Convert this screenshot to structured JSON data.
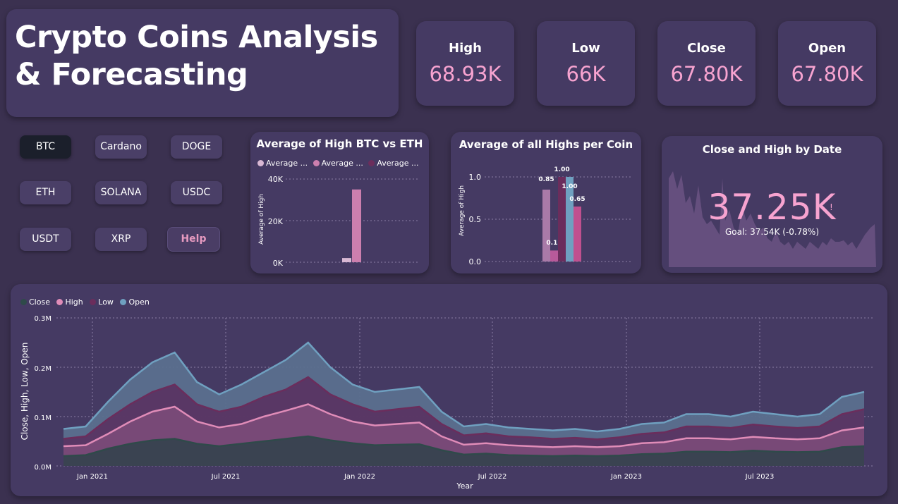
{
  "title": "Crypto Coins Analysis & Forecasting",
  "kpis": [
    {
      "label": "High",
      "value": "68.93K"
    },
    {
      "label": "Low",
      "value": "66K"
    },
    {
      "label": "Close",
      "value": "67.80K"
    },
    {
      "label": "Open",
      "value": "67.80K"
    }
  ],
  "buttons": {
    "btc": "BTC",
    "cardano": "Cardano",
    "doge": "DOGE",
    "eth": "ETH",
    "solana": "SOLANA",
    "usdc": "USDC",
    "usdt": "USDT",
    "xrp": "XRP",
    "help": "Help"
  },
  "colors": {
    "close": "#3e4a5a",
    "high": "#e08cb8",
    "low": "#6b2d5c",
    "open": "#6fa0c0",
    "kpi_value": "#f7a3d0"
  },
  "chart_btc_eth": {
    "title": "Average of High BTC vs ETH",
    "legend": [
      "Average ...",
      "Average ...",
      "Average ..."
    ],
    "legend_colors": [
      "#d9b8d4",
      "#cc7fae",
      "#6b2d5c"
    ],
    "ylabel": "Average of High",
    "ticks": [
      "40K",
      "20K",
      "0K"
    ]
  },
  "chart_coin_highs": {
    "title": "Average of all Highs per Coin",
    "ylabel": "Average of High",
    "ticks": [
      "1.0",
      "0.5",
      "0.0"
    ]
  },
  "gauge_card": {
    "title": "Close and High by Date",
    "value": "37.25K",
    "goal": "Goal: 37.54K (-0.78%)",
    "alert": "!"
  },
  "main_chart": {
    "legend": [
      "Close",
      "High",
      "Low",
      "Open"
    ],
    "ylabel": "Close, High, Low, Open",
    "xlabel": "Year",
    "yticks": [
      "0.3M",
      "0.2M",
      "0.1M",
      "0.0M"
    ],
    "xticks": [
      "Jan 2021",
      "Jul 2021",
      "Jan 2022",
      "Jul 2022",
      "Jan 2023",
      "Jul 2023"
    ]
  },
  "chart_data": [
    {
      "type": "bar",
      "title": "Average of High BTC vs ETH",
      "ylabel": "Average of High",
      "ylim": [
        0,
        40000
      ],
      "series": [
        {
          "values": [
            2000
          ]
        },
        {
          "values": [
            35000
          ]
        }
      ]
    },
    {
      "type": "bar",
      "title": "Average of all Highs per Coin",
      "ylabel": "Average of High",
      "ylim": [
        0,
        1.0
      ],
      "values": [
        0.85,
        0.13,
        1.0,
        1.0,
        0.65
      ],
      "data_labels": [
        "0.85",
        "0.13",
        "1.00",
        "1.00",
        "0.65"
      ],
      "colors": [
        "#a97aa8",
        "#b85a9a",
        "#6b2d5c",
        "#6fa0c0",
        "#c0508f"
      ]
    },
    {
      "type": "area",
      "title": "",
      "xlabel": "Year",
      "ylabel": "Close, High, Low, Open",
      "ylim": [
        0,
        300000
      ],
      "x": [
        "2020-12-01",
        "2021-01-01",
        "2021-02-01",
        "2021-03-01",
        "2021-04-01",
        "2021-05-01",
        "2021-06-01",
        "2021-07-01",
        "2021-08-01",
        "2021-09-01",
        "2021-10-01",
        "2021-11-01",
        "2021-12-01",
        "2022-01-01",
        "2022-02-01",
        "2022-03-01",
        "2022-04-01",
        "2022-05-01",
        "2022-06-01",
        "2022-07-01",
        "2022-08-01",
        "2022-09-01",
        "2022-10-01",
        "2022-11-01",
        "2022-12-01",
        "2023-01-01",
        "2023-02-01",
        "2023-03-01",
        "2023-04-01",
        "2023-05-01",
        "2023-06-01",
        "2023-07-01",
        "2023-08-01",
        "2023-09-01",
        "2023-10-01",
        "2023-11-01",
        "2023-12-01"
      ],
      "series": [
        {
          "name": "Open",
          "values": [
            75000,
            80000,
            130000,
            175000,
            210000,
            230000,
            170000,
            145000,
            165000,
            190000,
            215000,
            250000,
            200000,
            165000,
            150000,
            155000,
            160000,
            110000,
            80000,
            85000,
            78000,
            75000,
            72000,
            75000,
            70000,
            75000,
            85000,
            88000,
            105000,
            105000,
            100000,
            110000,
            105000,
            100000,
            105000,
            140000,
            150000
          ]
        },
        {
          "name": "Low",
          "values": [
            55000,
            60000,
            95000,
            125000,
            150000,
            165000,
            125000,
            110000,
            120000,
            140000,
            155000,
            180000,
            145000,
            125000,
            110000,
            115000,
            120000,
            85000,
            62000,
            66000,
            60000,
            58000,
            55000,
            57000,
            54000,
            58000,
            65000,
            68000,
            80000,
            80000,
            77000,
            84000,
            80000,
            77000,
            80000,
            105000,
            115000
          ]
        },
        {
          "name": "High",
          "values": [
            40000,
            42000,
            65000,
            90000,
            110000,
            120000,
            90000,
            78000,
            85000,
            100000,
            112000,
            125000,
            105000,
            90000,
            82000,
            85000,
            88000,
            60000,
            43000,
            46000,
            42000,
            40000,
            38000,
            40000,
            38000,
            40000,
            46000,
            48000,
            56000,
            56000,
            54000,
            59000,
            56000,
            54000,
            56000,
            72000,
            78000
          ]
        },
        {
          "name": "Close",
          "values": [
            20000,
            22000,
            35000,
            45000,
            52000,
            55000,
            45000,
            40000,
            45000,
            50000,
            55000,
            60000,
            52000,
            46000,
            42000,
            43000,
            44000,
            32000,
            23000,
            25000,
            22000,
            21000,
            20000,
            21000,
            20000,
            21000,
            24000,
            25000,
            29000,
            29000,
            28000,
            31000,
            29000,
            28000,
            29000,
            38000,
            40000
          ]
        }
      ]
    }
  ]
}
